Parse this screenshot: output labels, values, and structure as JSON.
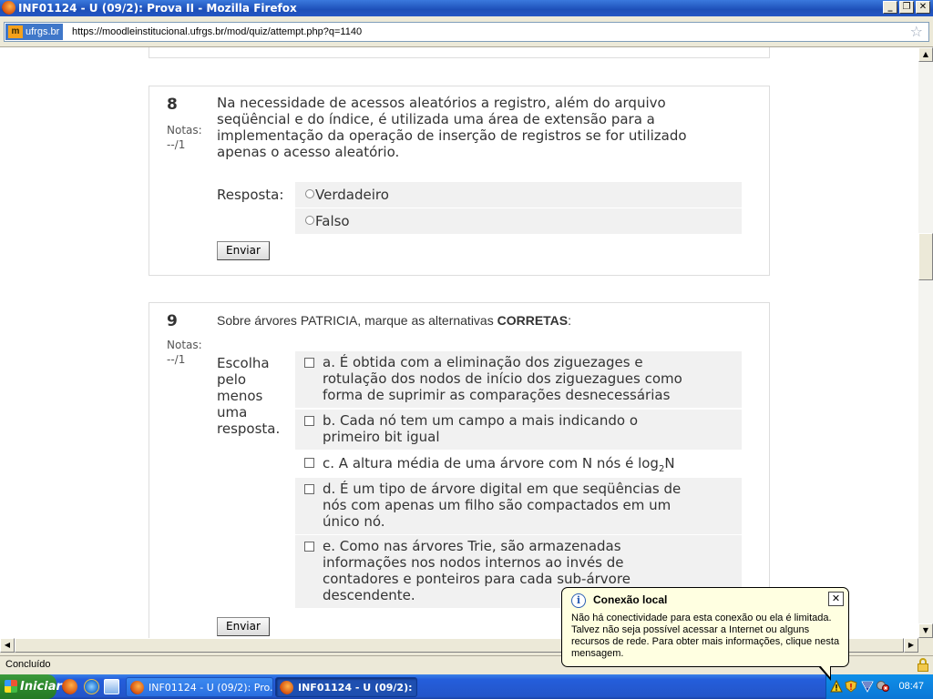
{
  "window": {
    "title": "INF01124 - U (09/2): Prova II - Mozilla Firefox",
    "buttons": {
      "minimize": "_",
      "restore": "❐",
      "close": "✕"
    }
  },
  "addressbar": {
    "site_identity": "ufrgs.br",
    "site_logo": "m",
    "url": "https://moodleinstitucional.ufrgs.br/mod/quiz/attempt.php?q=1140",
    "bookmark_icon": "star-icon"
  },
  "questions": [
    {
      "number": "8",
      "grade_label": "Notas:",
      "grade_value": "--/1",
      "text_lines": [
        "Na necessidade de acessos aleatórios a registro, além do arquivo",
        "seqüêncial e do índice, é utilizada uma área de extensão para a",
        "implementação da operação de inserção de registros se for utilizado",
        "apenas o acesso aleatório."
      ],
      "response_label": "Resposta:",
      "options": [
        "Verdadeiro",
        "Falso"
      ],
      "submit_label": "Enviar"
    },
    {
      "number": "9",
      "grade_label": "Notas:",
      "grade_value": "--/1",
      "text_prefix": "Sobre árvores PATRICIA, marque as alternativas ",
      "text_bold": "CORRETAS",
      "text_suffix": ":",
      "response_label_lines": [
        "Escolha",
        "pelo",
        "menos",
        "uma",
        "resposta."
      ],
      "options": [
        {
          "lines": [
            "a. É obtida com a eliminação dos ziguezages e",
            "rotulação dos nodos de início dos ziguezagues como",
            "forma de suprimir as comparações desnecessárias"
          ]
        },
        {
          "lines": [
            "b. Cada nó tem um campo a mais indicando o",
            "primeiro bit igual"
          ]
        },
        {
          "prefix": "c. A altura média de uma árvore com N nós é log",
          "subscript": "2",
          "suffix": "N"
        },
        {
          "lines": [
            "d. É um tipo de árvore digital em que seqüências de",
            "nós com apenas um filho são compactados em um",
            "único nó."
          ]
        },
        {
          "lines": [
            "e. Como nas árvores Trie, são armazenadas",
            "informações nos nodos internos ao invés de",
            "contadores e ponteiros para cada sub-árvore",
            "descendente."
          ]
        }
      ],
      "submit_label": "Enviar"
    }
  ],
  "statusbar": {
    "text": "Concluído"
  },
  "taskbar": {
    "start_label": "Iniciar",
    "tasks": [
      {
        "label": "INF01124 - U (09/2): Pro...",
        "active": false
      },
      {
        "label": "INF01124 - U (09/2): ...",
        "active": true
      }
    ],
    "clock": "08:47"
  },
  "notification": {
    "title": "Conexão local",
    "body": "Não há conectividade para esta conexão ou ela é limitada. Talvez não seja possível acessar a Internet ou alguns recursos de rede. Para obter mais informações, clique nesta mensagem.",
    "close_label": "✕",
    "icon_label": "i"
  }
}
